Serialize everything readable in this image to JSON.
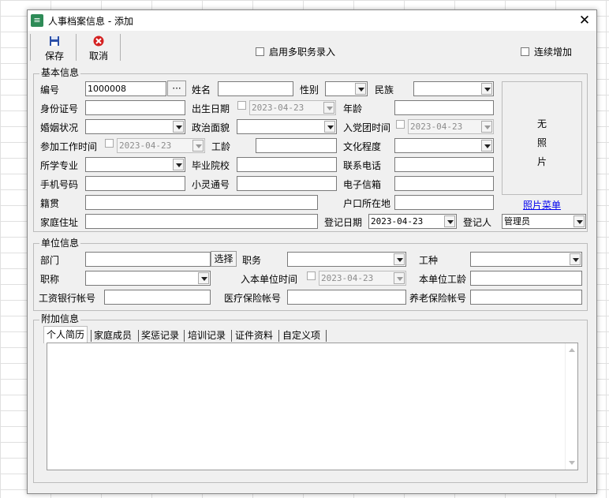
{
  "window": {
    "title": "人事档案信息 - 添加",
    "close": "✕"
  },
  "toolbar": {
    "save": "保存",
    "cancel": "取消",
    "multi_post": "启用多职务录入",
    "continuous_add": "连续增加"
  },
  "basic": {
    "group": "基本信息",
    "id_label": "编号",
    "id_value": "1000008",
    "ellipsis": "···",
    "name_label": "姓名",
    "gender_label": "性别",
    "ethnic_label": "民族",
    "idcard_label": "身份证号",
    "birth_label": "出生日期",
    "birth_value": "2023-04-23",
    "age_label": "年龄",
    "marital_label": "婚姻状况",
    "political_label": "政治面貌",
    "league_label": "入党团时间",
    "league_value": "2023-04-23",
    "work_start_label": "参加工作时间",
    "work_start_value": "2023-04-23",
    "seniority_label": "工龄",
    "education_label": "文化程度",
    "major_label": "所学专业",
    "school_label": "毕业院校",
    "phone_label": "联系电话",
    "mobile_label": "手机号码",
    "pas_label": "小灵通号",
    "email_label": "电子信箱",
    "native_label": "籍贯",
    "hukou_label": "户口所在地",
    "address_label": "家庭住址",
    "regdate_label": "登记日期",
    "regdate_value": "2023-04-23",
    "registrar_label": "登记人",
    "registrar_value": "管理员",
    "photo_chars": [
      "无",
      "照",
      "片"
    ],
    "photo_menu": "照片菜单"
  },
  "unit": {
    "group": "单位信息",
    "dept_label": "部门",
    "select_btn": "选择",
    "post_label": "职务",
    "worktype_label": "工种",
    "title_label": "职称",
    "join_label": "入本单位时间",
    "join_value": "2023-04-23",
    "unit_seniority_label": "本单位工龄",
    "bank_label": "工资银行帐号",
    "medical_label": "医疗保险帐号",
    "pension_label": "养老保险帐号"
  },
  "extra": {
    "group": "附加信息",
    "tabs": [
      "个人简历",
      "家庭成员",
      "奖惩记录",
      "培训记录",
      "证件资料",
      "自定义项"
    ]
  }
}
